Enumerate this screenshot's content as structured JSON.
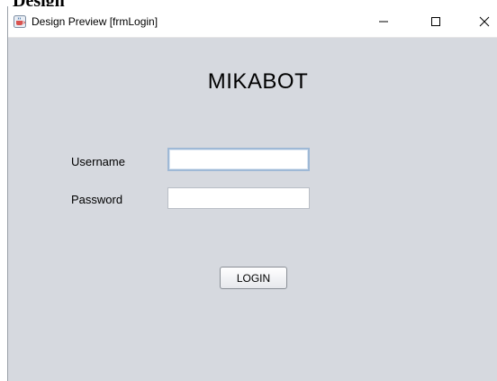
{
  "background": {
    "partial_text": "Design"
  },
  "window": {
    "title": "Design Preview [frmLogin]",
    "controls": {
      "minimize": "–",
      "maximize": "☐",
      "close": "✕"
    }
  },
  "form": {
    "heading": "MIKABOT",
    "username_label": "Username",
    "password_label": "Password",
    "username_value": "",
    "password_value": "",
    "login_label": "LOGIN"
  },
  "colors": {
    "form_background": "#d6d9df",
    "titlebar_background": "#ffffff",
    "focused_input_border": "#9fb9d6"
  },
  "icons": {
    "app_icon": "java-coffee-cup-icon"
  }
}
